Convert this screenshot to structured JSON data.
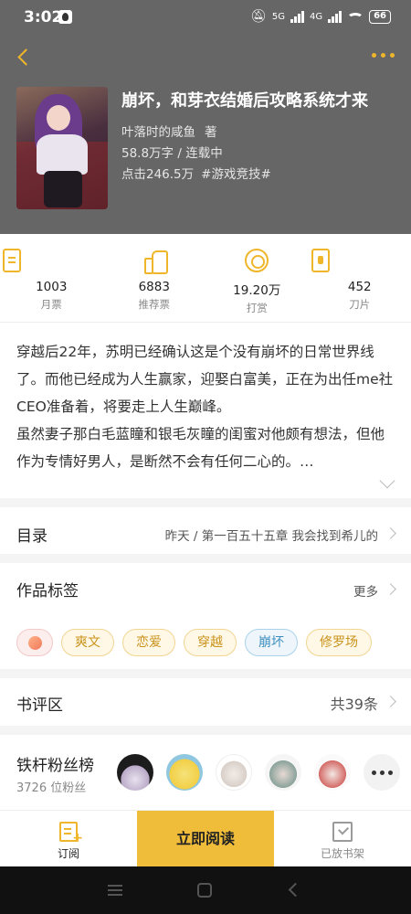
{
  "status_bar": {
    "time": "3:02",
    "network_5g": "5G",
    "network_4g": "4G",
    "battery": "66"
  },
  "book": {
    "title": "崩坏，和芽衣结婚后攻略系统才来",
    "author": "叶落时的咸鱼",
    "author_suffix": "著",
    "wordcount_status": "58.8万字 / 连载中",
    "clicks": "点击246.5万",
    "genre_tag": "#游戏竞技#"
  },
  "stats": [
    {
      "value": "1003",
      "label": "月票",
      "icon": "ticket-icon"
    },
    {
      "value": "6883",
      "label": "推荐票",
      "icon": "thumbs-up-icon"
    },
    {
      "value": "19.20万",
      "label": "打赏",
      "icon": "coin-icon"
    },
    {
      "value": "452",
      "label": "刀片",
      "icon": "blade-card-icon"
    }
  ],
  "synopsis": {
    "paragraph1": "穿越后22年，苏明已经确认这是个没有崩坏的日常世界线了。而他已经成为人生赢家，迎娶白富美，正在为出任me社CEO准备着，将要走上人生巅峰。",
    "paragraph2": "虽然妻子那白毛蓝瞳和银毛灰瞳的闺蜜对他颇有想法，但他作为专情好男人，是断然不会有任何二心的。…"
  },
  "toc": {
    "title": "目录",
    "latest": "昨天 / 第一百五十五章 我会找到希儿的"
  },
  "tags_section": {
    "title": "作品标签",
    "more": "更多",
    "tags": [
      "爽文",
      "恋爱",
      "穿越",
      "崩坏",
      "修罗场"
    ]
  },
  "reviews": {
    "title": "书评区",
    "count": "共39条"
  },
  "fans": {
    "title": "铁杆粉丝榜",
    "count": "3726 位粉丝"
  },
  "bottom_bar": {
    "subscribe": "订阅",
    "read_now": "立即阅读",
    "in_shelf": "已放书架"
  },
  "colors": {
    "accent": "#f0b62b",
    "header_bg": "#666666",
    "read_button": "#f0bd3a",
    "tag_blue": "#3e8fc0"
  }
}
